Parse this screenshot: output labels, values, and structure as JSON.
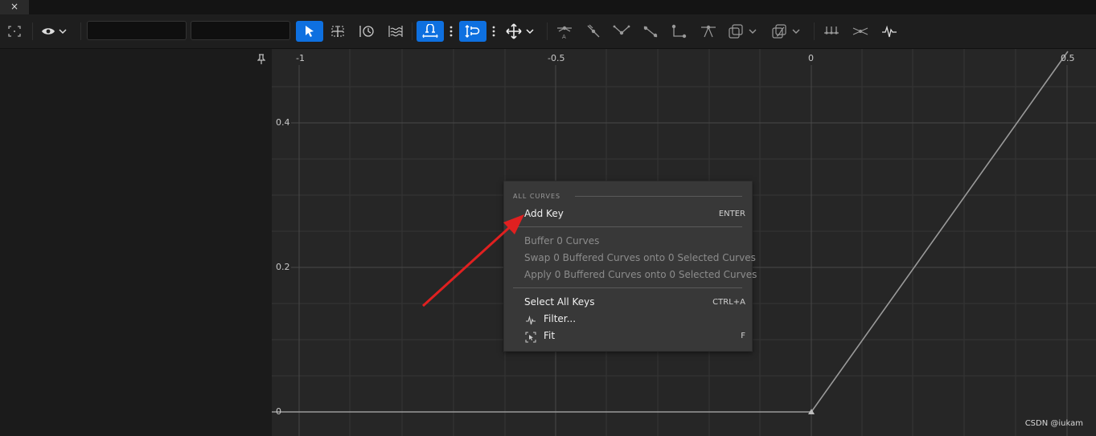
{
  "tab": {
    "close_glyph": "×"
  },
  "toolbar": {
    "search_value": "",
    "secondary_value": "",
    "icons": [
      "frame-icon",
      "eye-icon",
      "select-arrow-icon",
      "transform-icon",
      "retime-icon",
      "multiscale-icon",
      "snap-time-icon",
      "snap-value-icon",
      "move-icon",
      "auto-tangent-icon",
      "user-tangent-icon",
      "break-tangent-icon",
      "linear-icon",
      "constant-icon",
      "weighted-icon",
      "flatten-icon",
      "straighten-icon",
      "filter-icon"
    ]
  },
  "graph": {
    "x_ticks": [
      "-1",
      "-0.5",
      "0",
      "0.5"
    ],
    "y_ticks": [
      "0.4",
      "0.2",
      "0"
    ],
    "background": "#262626",
    "grid_color": "#3c3c3c",
    "curve_color": "#9a9a9a"
  },
  "menu": {
    "section": "ALL CURVES",
    "add_key": "Add Key",
    "add_key_shortcut": "ENTER",
    "buffer": "Buffer 0 Curves",
    "swap": "Swap 0 Buffered Curves onto 0 Selected Curves",
    "apply": "Apply 0 Buffered Curves onto 0 Selected Curves",
    "select_all": "Select All Keys",
    "select_all_shortcut": "CTRL+A",
    "filter": "Filter...",
    "fit": "Fit",
    "fit_shortcut": "F"
  },
  "annotation": {
    "arrow_color": "#e02020"
  },
  "watermark": "CSDN @iukam",
  "colors": {
    "accent": "#0e70e0"
  }
}
